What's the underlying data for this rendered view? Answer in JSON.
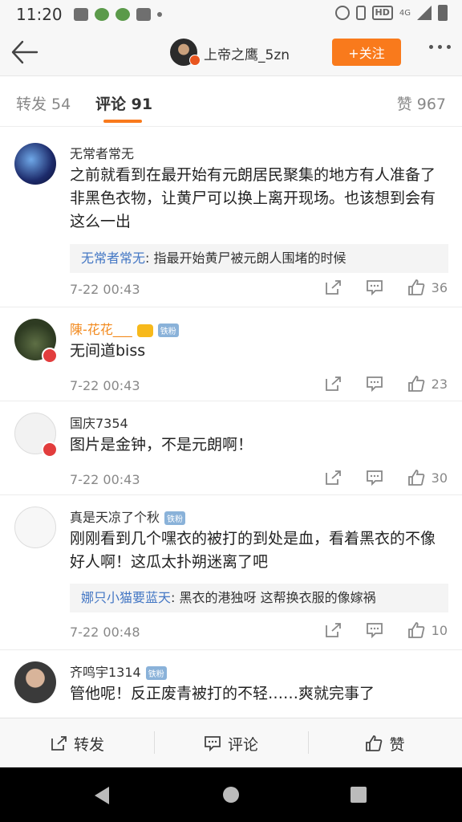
{
  "status_bar": {
    "time": "11:20",
    "network": "4G"
  },
  "header": {
    "username": "上帝之鹰_5zn",
    "follow_label": "+关注"
  },
  "tabs": {
    "repost": "转发 54",
    "comment": "评论 91",
    "like": "赞 967"
  },
  "comments": [
    {
      "name": "无常者常无",
      "text": "之前就看到在最开始有元朗居民聚集的地方有人准备了非黑色衣物，让黄尸可以换上离开现场。也该想到会有这么一出",
      "reply_author": "无常者常无",
      "reply_text": "指最开始黄尸被元朗人围堵的时候",
      "time": "7-22 00:43",
      "likes": "36"
    },
    {
      "name": "陳-花花___",
      "badge": "铁粉",
      "text": "无间道biss",
      "time": "7-22 00:43",
      "likes": "23"
    },
    {
      "name": "国庆7354",
      "text": "图片是金钟，不是元朗啊！",
      "time": "7-22 00:43",
      "likes": "30"
    },
    {
      "name": "真是天凉了个秋",
      "badge": "铁粉",
      "text": "刚刚看到几个嘿衣的被打的到处是血，看着黑衣的不像好人啊！这瓜太扑朔迷离了吧",
      "reply_author": "娜只小猫要蓝天",
      "reply_text": "黑衣的港独呀 这帮换衣服的像嫁祸",
      "time": "7-22 00:48",
      "likes": "10"
    },
    {
      "name": "齐鸣宇1314",
      "badge": "铁粉",
      "text": "管他呢！反正废青被打的不轻……爽就完事了"
    }
  ],
  "bottom_bar": {
    "repost": "转发",
    "comment": "评论",
    "like": "赞"
  },
  "colors": {
    "accent": "#f97a1c",
    "link": "#4477c4",
    "name_highlight": "#f28a1e"
  }
}
